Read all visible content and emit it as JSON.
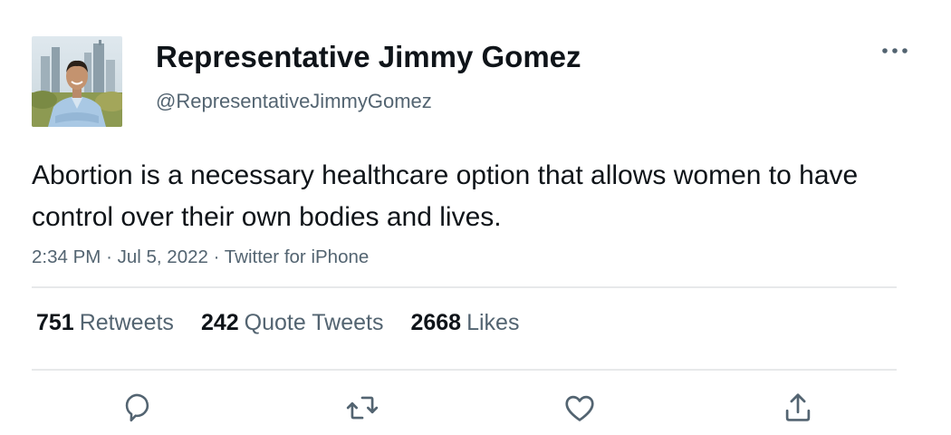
{
  "user": {
    "display_name": "Representative Jimmy Gomez",
    "handle": "@RepresentativeJimmyGomez",
    "avatar_icon": "profile-photo"
  },
  "tweet": {
    "text": "Abortion is a necessary healthcare option that allows women to have control over their own bodies and lives.",
    "time": "2:34 PM",
    "date": "Jul 5, 2022",
    "source": "Twitter for iPhone",
    "separator": "·"
  },
  "stats": {
    "retweets_count": "751",
    "retweets_label": "Retweets",
    "quotes_count": "242",
    "quotes_label": "Quote Tweets",
    "likes_count": "2668",
    "likes_label": "Likes"
  },
  "actions": {
    "reply_icon": "reply-icon",
    "retweet_icon": "retweet-icon",
    "like_icon": "like-icon",
    "share_icon": "share-icon"
  },
  "colors": {
    "text_primary": "#0f1419",
    "text_secondary": "#536471",
    "divider": "#e7e9ea"
  }
}
